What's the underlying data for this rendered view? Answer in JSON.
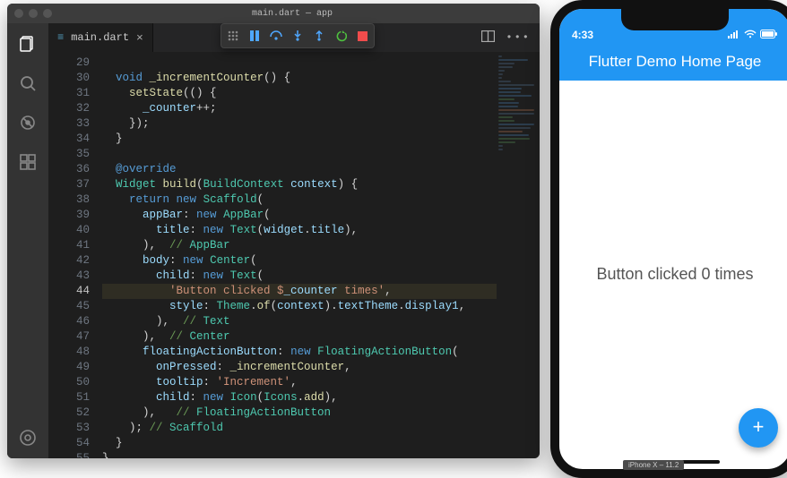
{
  "vscode": {
    "window_title": "main.dart — app",
    "tab": {
      "filename": "main.dart",
      "close_glyph": "×"
    },
    "debug_toolbar": [
      "drag",
      "pause",
      "step-over",
      "step-into",
      "step-out",
      "restart",
      "stop"
    ],
    "tabs_right": [
      "split-editor",
      "more"
    ],
    "activity": [
      "explorer",
      "search",
      "debug",
      "extensions"
    ],
    "activity_bottom": "settings",
    "line_start": 29,
    "line_end": 55,
    "highlight_line": 44,
    "code_lines": [
      "",
      "  void _incrementCounter() {",
      "    setState(() {",
      "      _counter++;",
      "    });",
      "  }",
      "",
      "  @override",
      "  Widget build(BuildContext context) {",
      "    return new Scaffold(",
      "      appBar: new AppBar(",
      "        title: new Text(widget.title),",
      "      ),  // AppBar",
      "      body: new Center(",
      "        child: new Text(",
      "          'Button clicked $_counter times',",
      "          style: Theme.of(context).textTheme.display1,",
      "        ),  // Text",
      "      ),  // Center",
      "      floatingActionButton: new FloatingActionButton(",
      "        onPressed: _incrementCounter,",
      "        tooltip: 'Increment',",
      "        child: new Icon(Icons.add),",
      "      ),   // FloatingActionButton",
      "    ); // Scaffold",
      "  }",
      "}"
    ]
  },
  "phone": {
    "time": "4:33",
    "appbar_title": "Flutter Demo Home Page",
    "body_text": "Button clicked 0 times",
    "fab_glyph": "+",
    "sim_label": "iPhone X – 11.2"
  }
}
